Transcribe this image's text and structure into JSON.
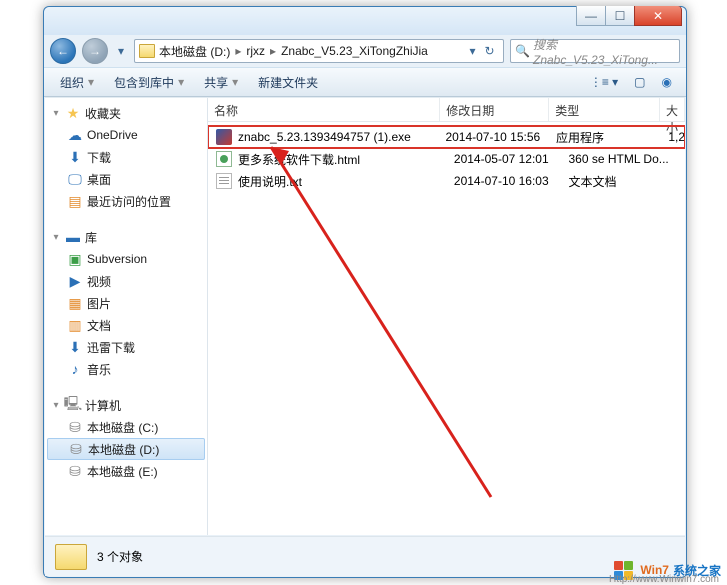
{
  "titlebar": {
    "min": "—",
    "max": "☐",
    "close": "✕"
  },
  "nav": {
    "back": "←",
    "fwd": "→",
    "dd": "▾",
    "refresh": "↻",
    "down": "▾"
  },
  "breadcrumb": [
    "本地磁盘 (D:)",
    "rjxz",
    "Znabc_V5.23_XiTongZhiJia"
  ],
  "search": {
    "placeholder": "搜索 Znabc_V5.23_XiTong..."
  },
  "toolbar": {
    "organize": "组织",
    "include": "包含到库中",
    "share": "共享",
    "newfolder": "新建文件夹"
  },
  "columns": {
    "name": "名称",
    "date": "修改日期",
    "type": "类型",
    "size": "大小"
  },
  "tree": {
    "fav": "收藏夹",
    "onedrive": "OneDrive",
    "downloads": "下载",
    "desktop": "桌面",
    "recent": "最近访问的位置",
    "lib": "库",
    "subversion": "Subversion",
    "video": "视频",
    "pictures": "图片",
    "docs": "文档",
    "xunlei": "迅雷下载",
    "music": "音乐",
    "computer": "计算机",
    "diskC": "本地磁盘 (C:)",
    "diskD": "本地磁盘 (D:)",
    "diskE": "本地磁盘 (E:)"
  },
  "files": [
    {
      "name": "znabc_5.23.1393494757 (1).exe",
      "date": "2014-07-10 15:56",
      "type": "应用程序",
      "size": "1,2",
      "highlight": true,
      "icon": "exe"
    },
    {
      "name": "更多系统软件下载.html",
      "date": "2014-05-07 12:01",
      "type": "360 se HTML Do...",
      "size": "",
      "highlight": false,
      "icon": "html"
    },
    {
      "name": "使用说明.txt",
      "date": "2014-07-10 16:03",
      "type": "文本文档",
      "size": "",
      "highlight": false,
      "icon": "txt"
    }
  ],
  "status": {
    "text": "3 个对象"
  },
  "watermark": {
    "brand1": "Win7",
    "brand2": "系统之家",
    "url": "Http://www.Winwin7.com"
  }
}
